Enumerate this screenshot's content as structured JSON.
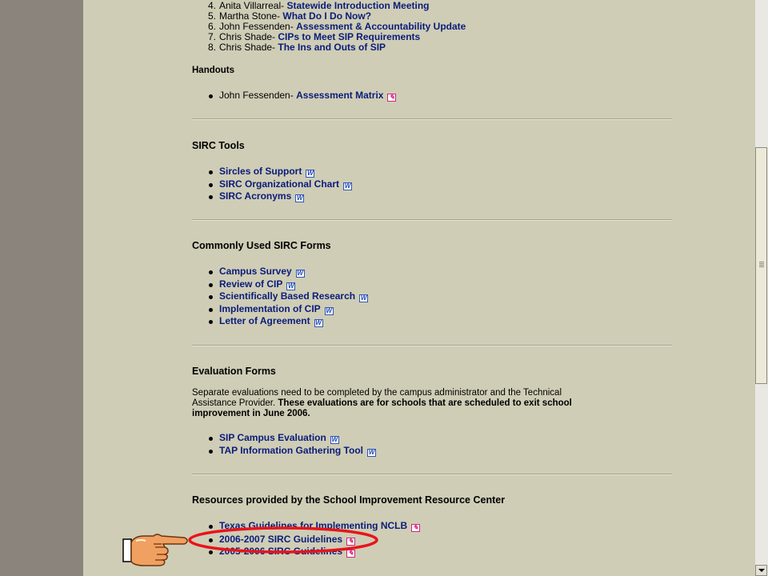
{
  "numbered_items": [
    {
      "num": "4.",
      "name": "Anita Villarreal- ",
      "title": "Statewide Introduction Meeting"
    },
    {
      "num": "5.",
      "name": "Martha Stone- ",
      "title": "What Do I Do Now?"
    },
    {
      "num": "6.",
      "name": "John Fessenden- ",
      "title": "Assessment & Accountability Update"
    },
    {
      "num": "7.",
      "name": "Chris Shade- ",
      "title": "CIPs to Meet SIP Requirements"
    },
    {
      "num": "8.",
      "name": "Chris Shade- ",
      "title": "The Ins and Outs of SIP"
    }
  ],
  "handouts": {
    "heading": "Handouts",
    "items": [
      {
        "prefix": "John Fessenden- ",
        "label": "Assessment Matrix",
        "icon": "pdf-icon"
      }
    ]
  },
  "sirc_tools": {
    "heading": "SIRC Tools",
    "items": [
      {
        "label": "Sircles of Support",
        "icon": "word-doc-icon"
      },
      {
        "label": "SIRC Organizational Chart",
        "icon": "word-doc-icon"
      },
      {
        "label": "SIRC Acronyms",
        "icon": "word-doc-icon"
      }
    ]
  },
  "forms": {
    "heading": "Commonly Used SIRC Forms",
    "items": [
      {
        "label": "Campus Survey",
        "icon": "word-doc-icon"
      },
      {
        "label": "Review of CIP",
        "icon": "word-doc-icon"
      },
      {
        "label": "Scientifically Based Research",
        "icon": "word-doc-icon"
      },
      {
        "label": "Implementation of CIP",
        "icon": "word-doc-icon"
      },
      {
        "label": "Letter of Agreement",
        "icon": "word-doc-icon"
      }
    ]
  },
  "evaluation": {
    "heading": "Evaluation Forms",
    "text": "Separate evaluations need to be completed by the campus administrator and the Technical Assistance Provider.",
    "bold_text": "These evaluations are for schools that are scheduled to exit school improvement in June 2006.",
    "items": [
      {
        "label": "SIP Campus Evaluation",
        "icon": "word-doc-icon"
      },
      {
        "label": "TAP Information Gathering Tool",
        "icon": "word-doc-icon"
      }
    ]
  },
  "resources": {
    "heading": "Resources provided by the School Improvement Resource Center",
    "items": [
      {
        "label": "Texas Guidelines for Implementing NCLB",
        "icon": "pdf-icon"
      },
      {
        "label": "2006-2007 SIRC Guidelines",
        "icon": "pdf-icon"
      },
      {
        "label": "2005-2006 SIRC Guidelines",
        "icon": "pdf-icon"
      }
    ]
  },
  "icons": {
    "word_glyph": "W",
    "pdf_glyph": "✎"
  },
  "colors": {
    "link": "#0a1c7a",
    "page_bg": "#cfcdb6",
    "outer_bg": "#8b847c",
    "annotation": "#e8141a"
  }
}
